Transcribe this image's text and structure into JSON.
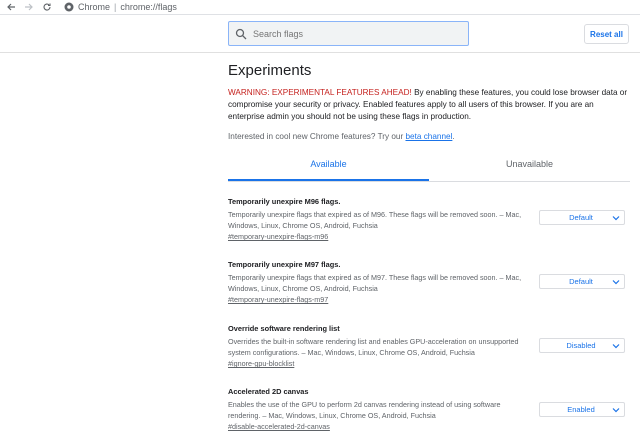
{
  "toolbar": {
    "site_chip": "Chrome",
    "separator": "|",
    "url": "chrome://flags"
  },
  "search": {
    "placeholder": "Search flags",
    "value": ""
  },
  "reset_label": "Reset all",
  "page_title": "Experiments",
  "warning": {
    "emphasis": "WARNING: EXPERIMENTAL FEATURES AHEAD!",
    "text": " By enabling these features, you could lose browser data or compromise your security or privacy. Enabled features apply to all users of this browser. If you are an enterprise admin you should not be using these flags in production."
  },
  "interest": {
    "text": "Interested in cool new Chrome features? Try our ",
    "link": "beta channel",
    "suffix": "."
  },
  "tabs": [
    {
      "label": "Available",
      "active": true
    },
    {
      "label": "Unavailable",
      "active": false
    }
  ],
  "experiments": [
    {
      "name": "Temporarily unexpire M96 flags.",
      "description": "Temporarily unexpire flags that expired as of M96. These flags will be removed soon. – Mac, Windows, Linux, Chrome OS, Android, Fuchsia",
      "link": "#temporary-unexpire-flags-m96",
      "value": "Default"
    },
    {
      "name": "Temporarily unexpire M97 flags.",
      "description": "Temporarily unexpire flags that expired as of M97. These flags will be removed soon. – Mac, Windows, Linux, Chrome OS, Android, Fuchsia",
      "link": "#temporary-unexpire-flags-m97",
      "value": "Default"
    },
    {
      "name": "Override software rendering list",
      "description": "Overrides the built-in software rendering list and enables GPU-acceleration on unsupported system configurations. – Mac, Windows, Linux, Chrome OS, Android, Fuchsia",
      "link": "#ignore-gpu-blocklist",
      "value": "Disabled"
    },
    {
      "name": "Accelerated 2D canvas",
      "description": "Enables the use of the GPU to perform 2d canvas rendering instead of using software rendering. – Mac, Windows, Linux, Chrome OS, Android, Fuchsia",
      "link": "#disable-accelerated-2d-canvas",
      "value": "Enabled"
    }
  ],
  "colors": {
    "accent": "#1a73e8",
    "warning": "#c5221f"
  }
}
